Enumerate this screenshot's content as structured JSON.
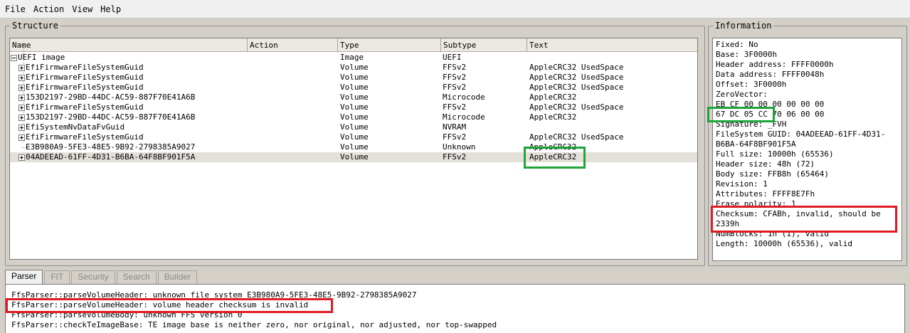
{
  "menu": [
    "File",
    "Action",
    "View",
    "Help"
  ],
  "structure": {
    "title": "Structure",
    "columns": [
      "Name",
      "Action",
      "Type",
      "Subtype",
      "Text"
    ],
    "rows": [
      {
        "name": "UEFI image",
        "action": "",
        "type": "Image",
        "subtype": "UEFI",
        "text": "",
        "expander": "minus",
        "root": true
      },
      {
        "name": "EfiFirmwareFileSystemGuid",
        "action": "",
        "type": "Volume",
        "subtype": "FFSv2",
        "text": "AppleCRC32 UsedSpace",
        "expander": "plus"
      },
      {
        "name": "EfiFirmwareFileSystemGuid",
        "action": "",
        "type": "Volume",
        "subtype": "FFSv2",
        "text": "AppleCRC32 UsedSpace",
        "expander": "plus"
      },
      {
        "name": "EfiFirmwareFileSystemGuid",
        "action": "",
        "type": "Volume",
        "subtype": "FFSv2",
        "text": "AppleCRC32 UsedSpace",
        "expander": "plus"
      },
      {
        "name": "153D2197-29BD-44DC-AC59-887F70E41A6B",
        "action": "",
        "type": "Volume",
        "subtype": "Microcode",
        "text": "AppleCRC32",
        "expander": "plus"
      },
      {
        "name": "EfiFirmwareFileSystemGuid",
        "action": "",
        "type": "Volume",
        "subtype": "FFSv2",
        "text": "AppleCRC32 UsedSpace",
        "expander": "plus"
      },
      {
        "name": "153D2197-29BD-44DC-AC59-887F70E41A6B",
        "action": "",
        "type": "Volume",
        "subtype": "Microcode",
        "text": "AppleCRC32",
        "expander": "plus"
      },
      {
        "name": "EfiSystemNvDataFvGuid",
        "action": "",
        "type": "Volume",
        "subtype": "NVRAM",
        "text": "",
        "expander": "plus"
      },
      {
        "name": "EfiFirmwareFileSystemGuid",
        "action": "",
        "type": "Volume",
        "subtype": "FFSv2",
        "text": "AppleCRC32 UsedSpace",
        "expander": "plus"
      },
      {
        "name": "E3B980A9-5FE3-48E5-9B92-2798385A9027",
        "action": "",
        "type": "Volume",
        "subtype": "Unknown",
        "text": "AppleCRC32",
        "expander": "none"
      },
      {
        "name": "04ADEEAD-61FF-4D31-B6BA-64F8BF901F5A",
        "action": "",
        "type": "Volume",
        "subtype": "FFSv2",
        "text": "AppleCRC32",
        "expander": "plus",
        "selected": true
      }
    ]
  },
  "information": {
    "title": "Information",
    "lines": [
      "Fixed: No",
      "Base: 3F0000h",
      "Header address: FFFF0000h",
      "Data address: FFFF0048h",
      "Offset: 3F0000h",
      "ZeroVector:",
      "EB CF 00 00 00 00 00 00",
      "67 DC 05 CC 70 06 00 00",
      "Signature: _FVH",
      "FileSystem GUID: 04ADEEAD-61FF-4D31-",
      "B6BA-64F8BF901F5A",
      "Full size: 10000h (65536)",
      "Header size: 48h (72)",
      "Body size: FFB8h (65464)",
      "Revision: 1",
      "Attributes: FFFF8E7Fh",
      "Erase polarity: 1",
      "Checksum: CFABh, invalid, should be",
      "2339h",
      "NumBlocks: 1h (1), valid",
      "Length: 10000h (65536), valid"
    ]
  },
  "tabs": [
    "Parser",
    "FIT",
    "Security",
    "Search",
    "Builder"
  ],
  "messages": [
    "FfsParser::parseVolumeHeader: unknown file system E3B980A9-5FE3-48E5-9B92-2798385A9027",
    "FfsParser::parseVolumeHeader: volume header checksum is invalid",
    "FfsParser::parseVolumeBody: unknown FFS version 0",
    "FfsParser::checkTeImageBase: TE image base is neither zero, nor original, nor adjusted, nor top-swapped"
  ],
  "colors": {
    "highlight_green": "#1fa43a",
    "highlight_red": "#e11b22",
    "selection": "#e3e0da"
  }
}
